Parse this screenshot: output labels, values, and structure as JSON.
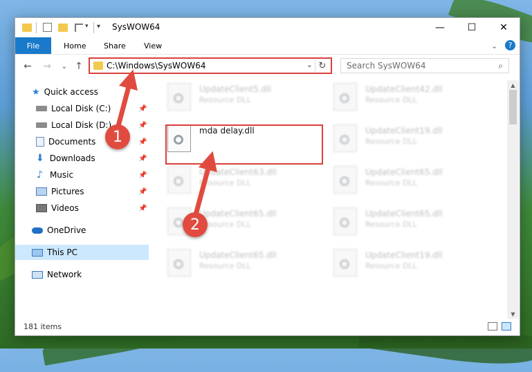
{
  "window": {
    "title": "SysWOW64",
    "minimize": "—",
    "maximize": "☐",
    "close": "✕"
  },
  "ribbon": {
    "tabs": [
      "File",
      "Home",
      "Share",
      "View"
    ],
    "expand": "⌄",
    "help": "?"
  },
  "nav": {
    "back": "←",
    "forward": "→",
    "recent": "⌄",
    "up": "↑",
    "address": "C:\\Windows\\SysWOW64",
    "address_dropdown": "⌄",
    "refresh": "↻",
    "search_placeholder": "Search SysWOW64",
    "search_icon": "⌕"
  },
  "sidebar": {
    "items": [
      {
        "label": "Quick access",
        "icon": "star-icon",
        "pinned": false
      },
      {
        "label": "Local Disk (C:)",
        "icon": "drive-icon",
        "pinned": true
      },
      {
        "label": "Local Disk (D:)",
        "icon": "drive-icon",
        "pinned": true
      },
      {
        "label": "Documents",
        "icon": "documents-icon",
        "pinned": true
      },
      {
        "label": "Downloads",
        "icon": "download-icon",
        "pinned": true
      },
      {
        "label": "Music",
        "icon": "music-icon",
        "pinned": true
      },
      {
        "label": "Pictures",
        "icon": "pictures-icon",
        "pinned": true
      },
      {
        "label": "Videos",
        "icon": "videos-icon",
        "pinned": true
      },
      {
        "label": "OneDrive",
        "icon": "cloud-icon",
        "pinned": false
      },
      {
        "label": "This PC",
        "icon": "computer-icon",
        "pinned": false,
        "selected": true
      },
      {
        "label": "Network",
        "icon": "network-icon",
        "pinned": false
      }
    ]
  },
  "files": [
    {
      "name": "UpdateClient5.dll",
      "type": "Resource DLL",
      "blurred": true
    },
    {
      "name": "UpdateClient42.dll",
      "type": "Resource DLL",
      "blurred": true
    },
    {
      "name": "mda delay.dll",
      "type": "",
      "blurred": false
    },
    {
      "name": "UpdateClient19.dll",
      "type": "Resource DLL",
      "blurred": true
    },
    {
      "name": "UpdateClient63.dll",
      "type": "Resource DLL",
      "blurred": true
    },
    {
      "name": "UpdateClient65.dll",
      "type": "Resource DLL",
      "blurred": true
    },
    {
      "name": "UpdateClient65.dll",
      "type": "Resource DLL",
      "blurred": true
    },
    {
      "name": "UpdateClient65.dll",
      "type": "Resource DLL",
      "blurred": true
    },
    {
      "name": "UpdateClient65.dll",
      "type": "Resource DLL",
      "blurred": true
    },
    {
      "name": "UpdateClient19.dll",
      "type": "Resource DLL",
      "blurred": true
    }
  ],
  "status": {
    "item_count": "181 items"
  },
  "annotations": {
    "step1": "1",
    "step2": "2"
  },
  "colors": {
    "accent": "#1979ca",
    "highlight": "#d9403b",
    "selected": "#cce8ff"
  }
}
